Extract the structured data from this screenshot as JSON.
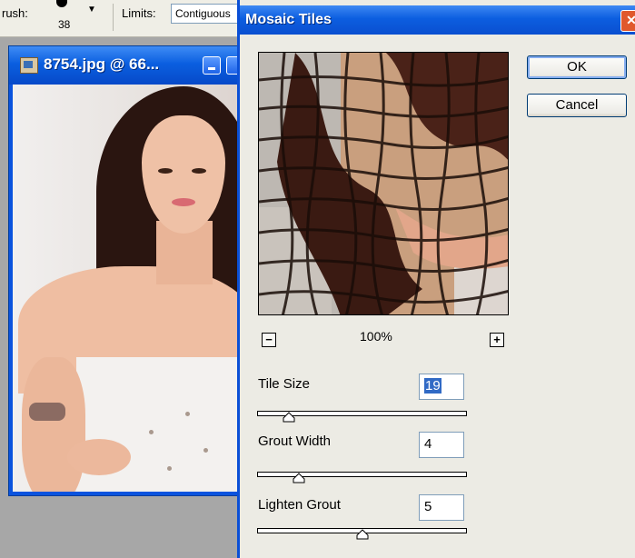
{
  "options_bar": {
    "brush_label": "rush:",
    "brush_size": "38",
    "limits_label": "Limits:",
    "limits_value": "Contiguous"
  },
  "document": {
    "title": "8754.jpg @ 66..."
  },
  "dialog": {
    "title": "Mosaic Tiles",
    "ok_label": "OK",
    "cancel_label": "Cancel",
    "zoom": "100%",
    "params": {
      "tile_size": {
        "label": "Tile Size",
        "value": "19",
        "fraction": 0.15
      },
      "grout_width": {
        "label": "Grout Width",
        "value": "4",
        "fraction": 0.2
      },
      "lighten_grout": {
        "label": "Lighten Grout",
        "value": "5",
        "fraction": 0.5
      }
    }
  },
  "colors": {
    "title_bar": "#0c5ee0",
    "dialog_bg": "#ecebe4",
    "field_selection": "#316ac5"
  }
}
